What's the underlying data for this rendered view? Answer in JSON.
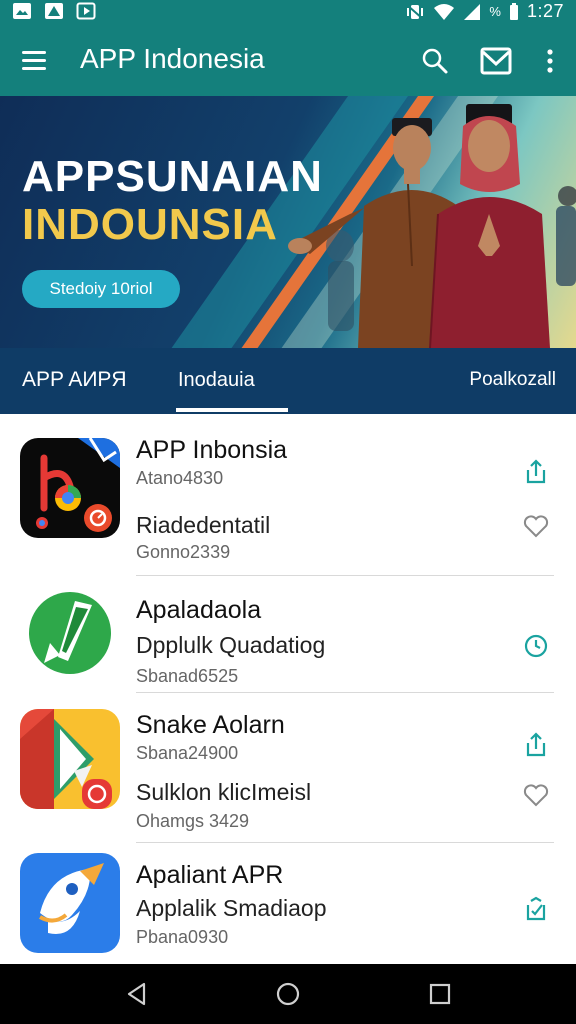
{
  "status_bar": {
    "time": "1:27",
    "battery_text": "%",
    "icons": [
      "notification-icon",
      "image-icon",
      "media-icon",
      "vibrate-icon",
      "wifi-icon",
      "signal-icon",
      "battery-icon"
    ]
  },
  "app_bar": {
    "title": "APP Indonesia",
    "icons": [
      "menu-icon",
      "search-icon",
      "inbox-icon",
      "more-vert-icon"
    ]
  },
  "banner": {
    "headline_line1": "APPSUNAIAN",
    "headline_line2": "INDOUNSIA",
    "cta_label": "Stedoiy 10riol",
    "colors": {
      "headline_line2": "#f2c94c",
      "cta": "#25a9c4",
      "background": "#0f2d57"
    }
  },
  "tabs": {
    "items": [
      {
        "label": "APP AИPЯ"
      },
      {
        "label": "Inodauia",
        "selected": true
      },
      {
        "label": "Poalkozall"
      }
    ]
  },
  "apps": [
    {
      "title": "APP Inbonsia",
      "subtitle": "Atano4830",
      "title2": "Riadedentatil",
      "subtitle2": "Gonno2339",
      "action1_icon": "share-icon",
      "action2_icon": "heart-icon"
    },
    {
      "title": "Apaladaola",
      "subtitle": "Dpplulk Quadatiog",
      "subtitle2": "Sbanad6525",
      "action1_icon": "clock-icon"
    },
    {
      "title": "Snake Aolarn",
      "subtitle": "Sbana24900",
      "title2": "Sulklon klicImeisl",
      "subtitle2": "Ohamgs 3429",
      "action1_icon": "share-icon",
      "action2_icon": "heart-icon"
    },
    {
      "title": "Apaliant APR",
      "subtitle": "Applalik Smadiaop",
      "subtitle2": "Pbana0930",
      "action1_icon": "download-check-icon"
    }
  ],
  "nav_bar": {
    "icons": [
      "back-icon",
      "home-icon",
      "recents-icon"
    ]
  },
  "colors": {
    "accent": "#14807c",
    "tabs_bg": "#0f3c66",
    "icon_teal": "#1aa3a0"
  }
}
